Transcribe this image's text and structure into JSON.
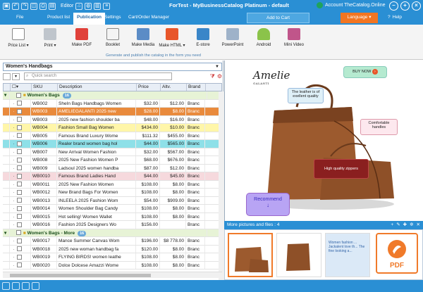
{
  "titlebar": {
    "editor_label": "Editor",
    "title": "ForTest - MyBusinessCatalog Platinum - default",
    "account": "Account TheCatalog.Online"
  },
  "menubar": {
    "items": [
      "File",
      "Product list",
      "Publication",
      "Settings",
      "Cart/Order Manager"
    ],
    "add_to_cart": "Add to Cart",
    "language": "Language",
    "help": "Help"
  },
  "ribbon": {
    "buttons": [
      "Price List",
      "Print",
      "Make PDF",
      "Booklet",
      "Make Media",
      "Make HTML",
      "E-store",
      "PowerPoint",
      "Android",
      "Mini Video"
    ],
    "caption": "Generate and publish the catalog in the form you need"
  },
  "left": {
    "category": "Women's Handbags",
    "search_placeholder": "Quick search",
    "columns": [
      "SKU",
      "Description",
      "Price",
      "Altv.",
      "Brand"
    ],
    "rows": [
      {
        "type": "group",
        "name": "Women's Bags",
        "count": "16"
      },
      {
        "type": "item",
        "sku": "WB002",
        "desc": "SheIn Bags Handbags Women",
        "price": "$32.00",
        "altv": "$12.00",
        "brand": "Branc"
      },
      {
        "type": "item",
        "sku": "WB003",
        "desc": "AMELIEGALANTI 2025 new",
        "price": "$28.00",
        "altv": "$8.00",
        "brand": "Branc",
        "style": "orange"
      },
      {
        "type": "item",
        "sku": "WB003",
        "desc": "2025 new fashion shoulder ba",
        "price": "$48.00",
        "altv": "$16.00",
        "brand": "Branc"
      },
      {
        "type": "item",
        "sku": "WB004",
        "desc": "Fashion Small Bag Women",
        "price": "$434.00",
        "altv": "$10.00",
        "brand": "Branc",
        "style": "yellow"
      },
      {
        "type": "item",
        "sku": "WB005",
        "desc": "Famous Brand Luxury Wome",
        "price": "$111.32",
        "altv": "$455.00",
        "brand": "Branc"
      },
      {
        "type": "item",
        "sku": "WB006",
        "desc": "Realer brand women bag hol",
        "price": "$44.00",
        "altv": "$565.00",
        "brand": "Branc",
        "style": "cyan"
      },
      {
        "type": "item",
        "sku": "WB007",
        "desc": "New Arrival Women Fashion",
        "price": "$32.00",
        "altv": "$567.00",
        "brand": "Branc"
      },
      {
        "type": "item",
        "sku": "WB008",
        "desc": "2025 New Fashion Women P",
        "price": "$68.00",
        "altv": "$676.00",
        "brand": "Branc"
      },
      {
        "type": "item",
        "sku": "WB009",
        "desc": "Ladsoul 2025 women handba",
        "price": "$87.00",
        "altv": "$12.00",
        "brand": "Branc"
      },
      {
        "type": "item",
        "sku": "WB0010",
        "desc": "Famous Brand Ladies Hand",
        "price": "$44.00",
        "altv": "$45.00",
        "brand": "Branc",
        "style": "pink"
      },
      {
        "type": "item",
        "sku": "WB0011",
        "desc": "2025 New Fashion Women",
        "price": "$108.00",
        "altv": "$8.00",
        "brand": "Branc"
      },
      {
        "type": "item",
        "sku": "WB0012",
        "desc": "New Brand Bags For Women",
        "price": "$108.00",
        "altv": "$8.00",
        "brand": "Branc"
      },
      {
        "type": "item",
        "sku": "WB0013",
        "desc": "INLEELA 2025 Fashion Wom",
        "price": "$54.00",
        "altv": "$909.00",
        "brand": "Branc"
      },
      {
        "type": "item",
        "sku": "WB0014",
        "desc": "Women Shoulder Bag Candy",
        "price": "$108.00",
        "altv": "$8.00",
        "brand": "Branc"
      },
      {
        "type": "item",
        "sku": "WB0015",
        "desc": "Hot selling! Women Wallet",
        "price": "$108.00",
        "altv": "$8.00",
        "brand": "Branc"
      },
      {
        "type": "item",
        "sku": "WB0016",
        "desc": "Fashion 2025 Designers Wo",
        "price": "$156.00",
        "altv": "",
        "brand": "Branc"
      },
      {
        "type": "group",
        "name": "Women's Bags - More",
        "count": "16"
      },
      {
        "type": "item",
        "sku": "WB0017",
        "desc": "Mance Summer Canvas Wom",
        "price": "$196.00",
        "altv": "$8 778.00",
        "brand": "Branc"
      },
      {
        "type": "item",
        "sku": "WB0018",
        "desc": "2025 new woman handbag fa",
        "price": "$120.00",
        "altv": "$8.00",
        "brand": "Branc"
      },
      {
        "type": "item",
        "sku": "WB0019",
        "desc": "FLYING BIRDS! women leathe",
        "price": "$108.00",
        "altv": "$8.00",
        "brand": "Branc"
      },
      {
        "type": "item",
        "sku": "WB0020",
        "desc": "Dolce Dolcese Amazzi Wome",
        "price": "$108.00",
        "altv": "$8.00",
        "brand": "Branc"
      }
    ]
  },
  "preview": {
    "logo": "Amelie",
    "logo_sub": "GALANTI",
    "buy_now": "BUY NOW",
    "callout_leather": "The leather is of exellent quality",
    "callout_handles": "Comfortable handles",
    "callout_zippers": "High quality zippers",
    "recommend": "Recommend"
  },
  "more": {
    "label": "More pictures and files :",
    "count": "4",
    "text_thumb": "Women fashion ... Jackalent love th... The fine looking a...",
    "pdf_label": "PDF"
  },
  "colors": {
    "brand_blue": "#2a8fd4",
    "accent_orange": "#f27521"
  }
}
